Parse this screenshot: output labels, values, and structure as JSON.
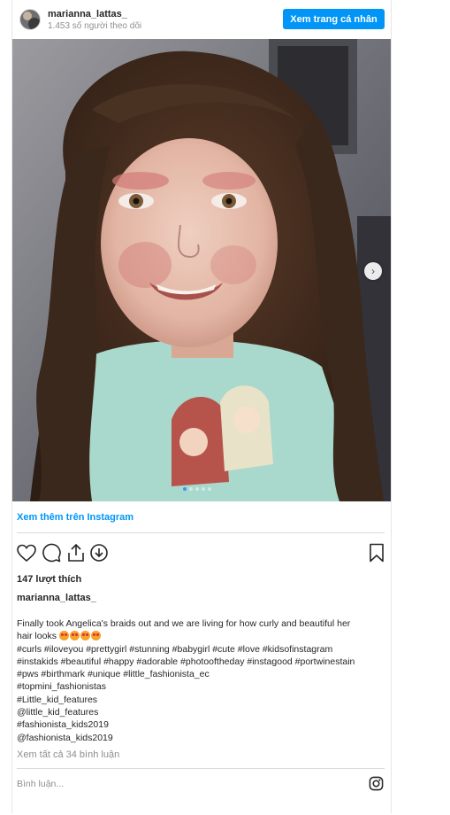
{
  "header": {
    "username": "marianna_lattas_",
    "followers": "1.453 số người theo dõi",
    "profile_button": "Xem trang cá nhân"
  },
  "photo": {
    "carousel_dots": 5,
    "active_dot": 0
  },
  "view_more_link": "Xem thêm trên Instagram",
  "likes": "147 lượt thích",
  "caption": {
    "author": "marianna_lattas_",
    "lines": [
      "Finally took Angelica's braids out and we are living for how curly and beautiful her",
      "hair looks",
      "#curls #iloveyou #prettygirl #stunning #babygirl #cute #love #kidsofinstagram",
      "#instakids #beautiful #happy #adorable #photooftheday #instagood #portwinestain",
      "#pws #birthmark #unique #little_fashionista_ec",
      "#topmini_fashionistas",
      "#Little_kid_features",
      "@little_kid_features",
      "#fashionista_kids2019",
      "@fashionista_kids2019"
    ],
    "emoji": "heart-eyes-emoji"
  },
  "comments_link": "Xem tất cả 34 bình luận",
  "comment_placeholder": "Bình luận...",
  "colors": {
    "accent": "#0095f6",
    "text": "#262626",
    "muted": "#8e8e8e",
    "divider": "#dbdbdb"
  },
  "icons": [
    "heart-icon",
    "comment-icon",
    "share-icon",
    "download-icon",
    "bookmark-icon",
    "instagram-icon",
    "next-arrow-icon"
  ]
}
